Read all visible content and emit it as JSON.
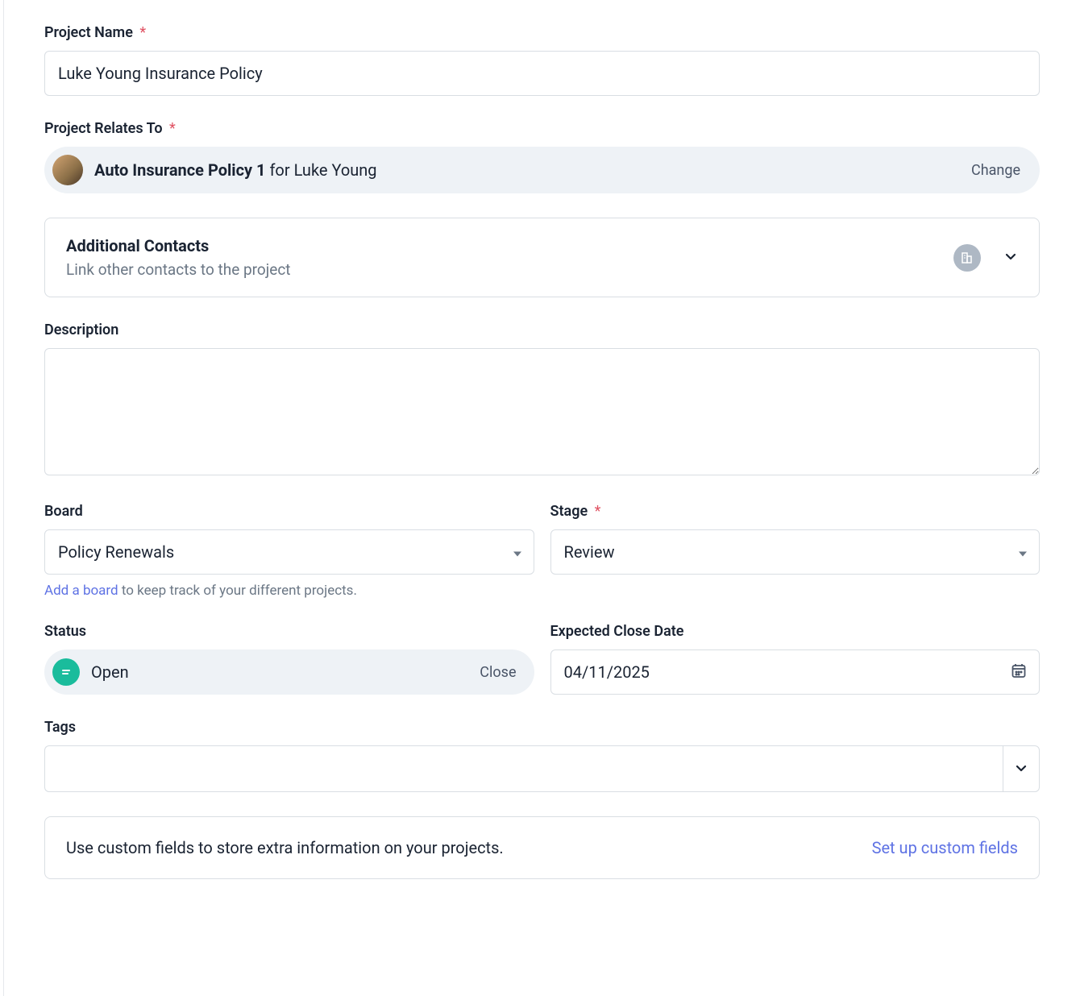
{
  "projectName": {
    "label": "Project Name",
    "required": "*",
    "value": "Luke Young Insurance Policy"
  },
  "relatesTo": {
    "label": "Project Relates To",
    "required": "*",
    "bold": "Auto Insurance Policy 1",
    "rest": " for Luke Young",
    "changeLabel": "Change"
  },
  "contacts": {
    "title": "Additional Contacts",
    "sub": "Link other contacts to the project"
  },
  "description": {
    "label": "Description",
    "value": ""
  },
  "board": {
    "label": "Board",
    "value": "Policy Renewals",
    "helperLink": "Add a board",
    "helperRest": " to keep track of your different projects."
  },
  "stage": {
    "label": "Stage",
    "required": "*",
    "value": "Review"
  },
  "status": {
    "label": "Status",
    "value": "Open",
    "closeLabel": "Close"
  },
  "closeDate": {
    "label": "Expected Close Date",
    "value": "04/11/2025"
  },
  "tags": {
    "label": "Tags",
    "value": ""
  },
  "custom": {
    "text": "Use custom fields to store extra information on your projects.",
    "link": "Set up custom fields"
  }
}
